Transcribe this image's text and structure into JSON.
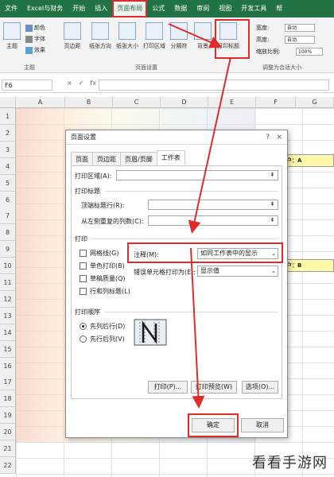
{
  "ribbon": {
    "tabs": [
      "文件",
      "Excel与财务",
      "开始",
      "插入",
      "页面布局",
      "公式",
      "数据",
      "审阅",
      "视图",
      "开发工具",
      "帮"
    ],
    "active_tab_index": 4,
    "theme_group": {
      "main": "主题",
      "colors": "颜色",
      "fonts": "字体",
      "effects": "效果",
      "label": "主题"
    },
    "page_setup_group": {
      "buttons": [
        "页边距",
        "纸张方向",
        "纸张大小",
        "打印区域",
        "分隔符",
        "背景",
        "打印标题"
      ],
      "label": "页面设置"
    },
    "scale_group": {
      "width_label": "宽度:",
      "width_value": "自动",
      "height_label": "高度:",
      "height_value": "自动",
      "scale_label": "缩放比例:",
      "scale_value": "100%",
      "label": "调整为合适大小"
    }
  },
  "formula_bar": {
    "name_box": "F6",
    "fx_cancel": "×",
    "fx_enter": "✓",
    "fx": "fx"
  },
  "sheet": {
    "columns": [
      "A",
      "B",
      "C",
      "D",
      "E",
      "F",
      "G"
    ],
    "rows": [
      "1",
      "2",
      "3",
      "4",
      "5",
      "6",
      "7",
      "8",
      "9",
      "10",
      "11",
      "12",
      "13",
      "14",
      "15",
      "16",
      "17",
      "18",
      "19",
      "20",
      "21",
      "22"
    ],
    "notes": [
      "户：A",
      "户：B"
    ]
  },
  "dialog": {
    "title": "页面设置",
    "help": "?",
    "close": "×",
    "tabs": [
      "页面",
      "页边距",
      "页眉/页脚",
      "工作表"
    ],
    "active_tab_index": 3,
    "print_area_label": "打印区域(A):",
    "print_titles_label": "打印标题",
    "top_rows_label": "顶端标题行(R):",
    "left_cols_label": "从左侧重复的列数(C):",
    "print_section_label": "打印",
    "checkboxes": [
      "网格线(G)",
      "单色打印(B)",
      "草稿质量(Q)",
      "行和列标题(L)"
    ],
    "comments_label": "注释(M):",
    "comments_value": "如同工作表中的显示",
    "errors_label": "错误单元格打印为(E):",
    "errors_value": "显示值",
    "order_section_label": "打印顺序",
    "order_options": [
      "先列后行(D)",
      "先行后列(V)"
    ],
    "order_selected_index": 0,
    "print_button": "打印(P)...",
    "preview_button": "打印预览(W)",
    "options_button": "选项(O)...",
    "ok_button": "确定",
    "cancel_button": "取消"
  },
  "watermark": "看看手游网",
  "colors": {
    "ribbon_green": "#217346",
    "highlight_red": "#e02b2b"
  }
}
